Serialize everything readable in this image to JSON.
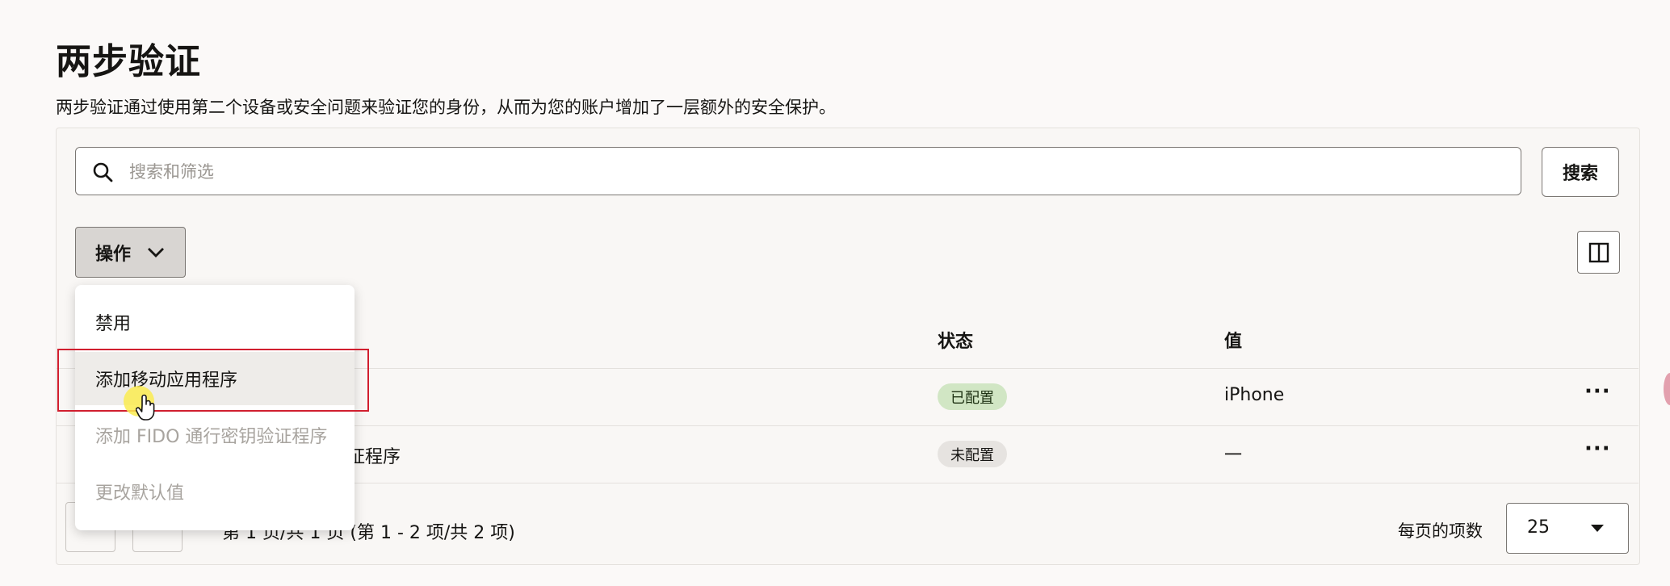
{
  "page": {
    "title": "两步验证",
    "description": "两步验证通过使用第二个设备或安全问题来验证您的身份，从而为您的账户增加了一层额外的安全保护。"
  },
  "toolbar": {
    "search_placeholder": "搜索和筛选",
    "search_button": "搜索",
    "actions_label": "操作"
  },
  "table": {
    "headers": {
      "status": "状态",
      "value": "值"
    },
    "rows": [
      {
        "name": "",
        "status": "已配置",
        "value": "iPhone"
      },
      {
        "name": "证程序",
        "status": "未配置",
        "value": "一"
      }
    ]
  },
  "actions_menu": {
    "items": [
      {
        "label": "禁用",
        "disabled": false
      },
      {
        "label": "添加移动应用程序",
        "disabled": false
      },
      {
        "label": "添加 FIDO 通行密钥验证程序",
        "disabled": true
      },
      {
        "label": "更改默认值",
        "disabled": true
      }
    ]
  },
  "pagination": {
    "summary": "第 1 页/共 1 页 (第 1 - 2 项/共 2 项)",
    "per_page_label": "每页的项数",
    "per_page_value": "25"
  },
  "colors": {
    "configured_badge": "#d1e6c4",
    "unconfigured_badge": "#e6e3e0",
    "highlight": "#d11f2f"
  }
}
